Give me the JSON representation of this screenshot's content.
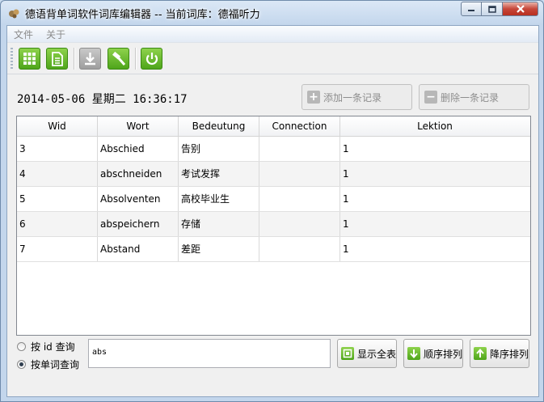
{
  "window": {
    "title": "德语背单词软件词库编辑器 -- 当前词库：德福听力"
  },
  "menu": {
    "items": [
      "文件",
      "关于"
    ]
  },
  "toolbar": {
    "buttons": [
      {
        "icon": "grid-icon",
        "color": "#5db526"
      },
      {
        "icon": "document-icon",
        "color": "#5db526"
      },
      {
        "icon": "download-icon",
        "color": "#a8a8a8"
      },
      {
        "icon": "hammer-icon",
        "color": "#5db526"
      },
      {
        "icon": "power-icon",
        "color": "#5db526"
      }
    ]
  },
  "datetime": "2014-05-06 星期二 16:36:17",
  "actions": {
    "add_label": "添加一条记录",
    "delete_label": "删除一条记录"
  },
  "table": {
    "columns": [
      "Wid",
      "Wort",
      "Bedeutung",
      "Connection",
      "Lektion"
    ],
    "rows": [
      [
        "3",
        "Abschied",
        "告别",
        "",
        "1"
      ],
      [
        "4",
        "abschneiden",
        "考试发挥",
        "",
        "1"
      ],
      [
        "5",
        "Absolventen",
        "高校毕业生",
        "",
        "1"
      ],
      [
        "6",
        "abspeichern",
        "存储",
        "",
        "1"
      ],
      [
        "7",
        "Abstand",
        "差距",
        "",
        "1"
      ]
    ]
  },
  "query": {
    "mode_id_label": "按 id 查询",
    "mode_word_label": "按单词查询",
    "selected": "word",
    "search_value": "abs"
  },
  "bottom_buttons": {
    "show_all": "显示全表",
    "sort_asc": "顺序排列",
    "sort_desc": "降序排列"
  }
}
